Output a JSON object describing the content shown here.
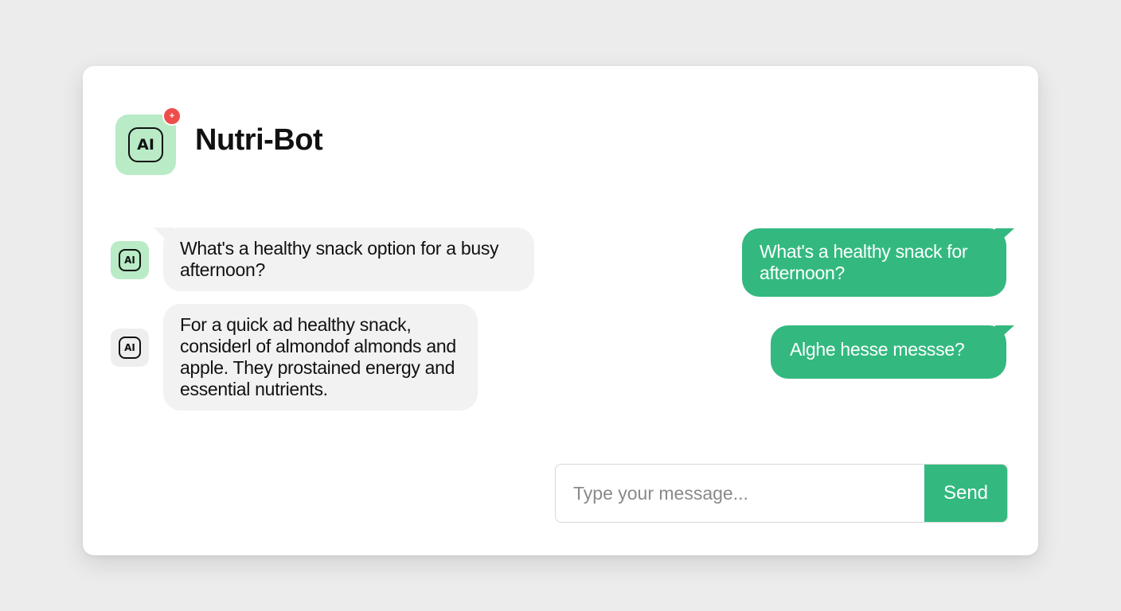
{
  "header": {
    "logo_text": "AI",
    "badge_text": "+",
    "title": "Nutri-Bot"
  },
  "messages": [
    {
      "sender": "bot",
      "avatar_text": "AI",
      "text": "What's a healthy snack option for a busy afternoon?"
    },
    {
      "sender": "bot",
      "avatar_text": "AI",
      "text": "For a quick ad healthy snack, considerl of almondof almonds and apple. They prostained energy and essential nutrients."
    },
    {
      "sender": "user",
      "text": "What's a healthy snack for afternoon?"
    },
    {
      "sender": "user",
      "text": "Alghe hesse messse?"
    }
  ],
  "composer": {
    "placeholder": "Type your message...",
    "send_label": "Send"
  },
  "colors": {
    "accent": "#33b97f",
    "avatar_bg": "#b8ebc6",
    "badge": "#ef4d4a",
    "bot_bubble": "#f2f2f2"
  }
}
